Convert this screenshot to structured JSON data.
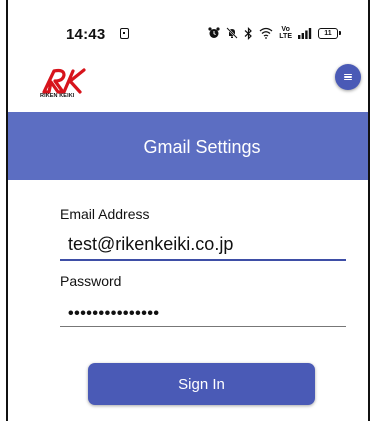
{
  "status_bar": {
    "time": "14:43",
    "lte_top": "Vo",
    "lte_bottom": "LTE",
    "battery_level": "11",
    "icons": [
      "alarm-icon",
      "mute-icon",
      "bluetooth-icon",
      "wifi-icon",
      "signal-icon",
      "battery-icon"
    ]
  },
  "header": {
    "logo_text": "RIKEN KEIKI",
    "brand_color": "#d7141c",
    "menu_icon": "hamburger-menu-icon"
  },
  "banner": {
    "title": "Gmail Settings",
    "color": "#5c6ec2"
  },
  "form": {
    "email_label": "Email Address",
    "email_value": "test@rikenkeiki.co.jp",
    "password_label": "Password",
    "password_value": "•••••••••••••••",
    "submit_label": "Sign In",
    "accent_color": "#4a5ab6"
  }
}
